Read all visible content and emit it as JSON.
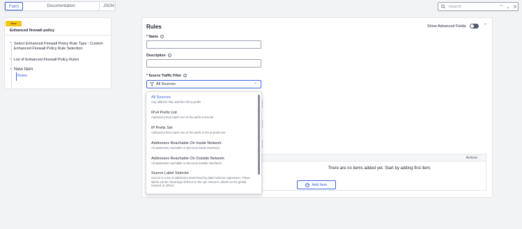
{
  "tabs": [
    {
      "label": "Form"
    },
    {
      "label": "Documentation"
    },
    {
      "label": "JSON"
    }
  ],
  "search": {
    "placeholder": "Search"
  },
  "left_panel": {
    "badge": "New",
    "title": "Enhanced firewall policy",
    "items": [
      {
        "label": "Select Enhanced Firewall Policy Rule Type : Custom Enhanced Firewall Policy Rule Selection"
      },
      {
        "label": "List of Enhanced Firewall Policy Rules"
      },
      {
        "label": "New Item"
      }
    ],
    "sub_item": "Rules"
  },
  "form": {
    "title": "Rules",
    "advanced_label": "Show Advanced Fields",
    "name_label": "* Name",
    "description_label": "Description",
    "source_label": "* Source Traffic Filter",
    "source_value": "All Sources"
  },
  "dropdown": {
    "options": [
      {
        "title": "All Sources",
        "desc": "Any address that matches 0/0 ip prefix"
      },
      {
        "title": "IPv4 Prefix List",
        "desc": "Addresses that match one of the prefix in the list"
      },
      {
        "title": "IP Prefix Set",
        "desc": "Addresses that match one of the prefix in the ip-prefix-set"
      },
      {
        "title": "Addresses Reachable On Inside Network",
        "desc": "All addresses reachable in site-local inside interfaces"
      },
      {
        "title": "Addresses Reachable On Outside Network",
        "desc": "All addresses reachable in site-local outside interfaces"
      },
      {
        "title": "Source Label Selector",
        "desc": "Source is a set of addresses determined by label selector expression. These labels can be cloud tags defined on the vpc resource, labels on the global network or others."
      }
    ]
  },
  "table": {
    "actions_header": "Actions",
    "empty_message": "There are no items added yet. Start by adding first item.",
    "add_button": "Add Item"
  },
  "colors": {
    "accent": "#3a64d8",
    "badge": "#f5c518"
  }
}
